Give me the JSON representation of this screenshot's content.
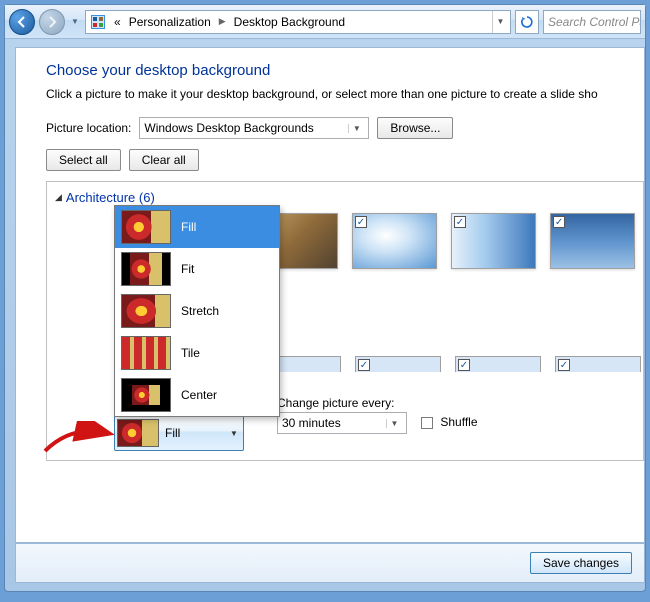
{
  "nav": {
    "breadcrumb_prefix": "«",
    "breadcrumb_part1": "Personalization",
    "breadcrumb_part2": "Desktop Background",
    "search_placeholder": "Search Control Pa"
  },
  "heading": "Choose your desktop background",
  "subheading": "Click a picture to make it your desktop background, or select more than one picture to create a slide sho",
  "picture_location_label": "Picture location:",
  "picture_location_value": "Windows Desktop Backgrounds",
  "browse_btn": "Browse...",
  "select_all_btn": "Select all",
  "clear_all_btn": "Clear all",
  "group_title": "Architecture (6)",
  "position_options": {
    "fill": "Fill",
    "fit": "Fit",
    "stretch": "Stretch",
    "tile": "Tile",
    "center": "Center"
  },
  "position_selected": "Fill",
  "change_label": "Change picture every:",
  "change_value": "30 minutes",
  "shuffle_label": "Shuffle",
  "save_btn": "Save changes"
}
